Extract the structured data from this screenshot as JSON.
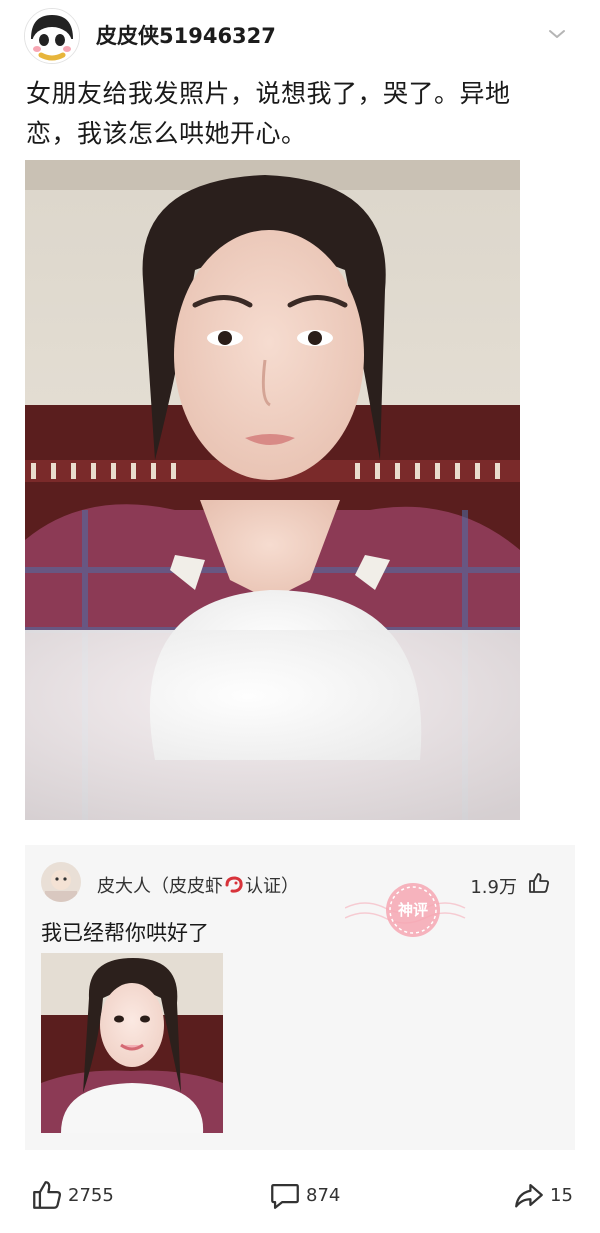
{
  "post": {
    "username": "皮皮侠51946327",
    "text": "女朋友给我发照片，说想我了，哭了。异地恋，我该怎么哄她开心。",
    "icons": {
      "menu": "chevron-down-icon",
      "avatar": "cartoon-avatar"
    }
  },
  "comment": {
    "user_name": "皮大人",
    "user_suffix_open": "（皮皮虾",
    "user_suffix_close": "认证）",
    "likes": "1.9万",
    "text": "我已经帮你哄好了",
    "stamp_label": "神评",
    "icons": {
      "like": "thumbs-up-icon",
      "verify": "shrimp-badge-icon",
      "stamp": "god-comment-stamp-icon"
    }
  },
  "actions": {
    "likes": "2755",
    "comments": "874",
    "shares": "15",
    "icons": {
      "like": "thumbs-up-icon",
      "comment": "comment-bubble-icon",
      "share": "share-arrow-icon"
    }
  },
  "colors": {
    "accent": "#f06a7a",
    "text": "#1a1a1a",
    "panel": "#f6f6f6"
  }
}
